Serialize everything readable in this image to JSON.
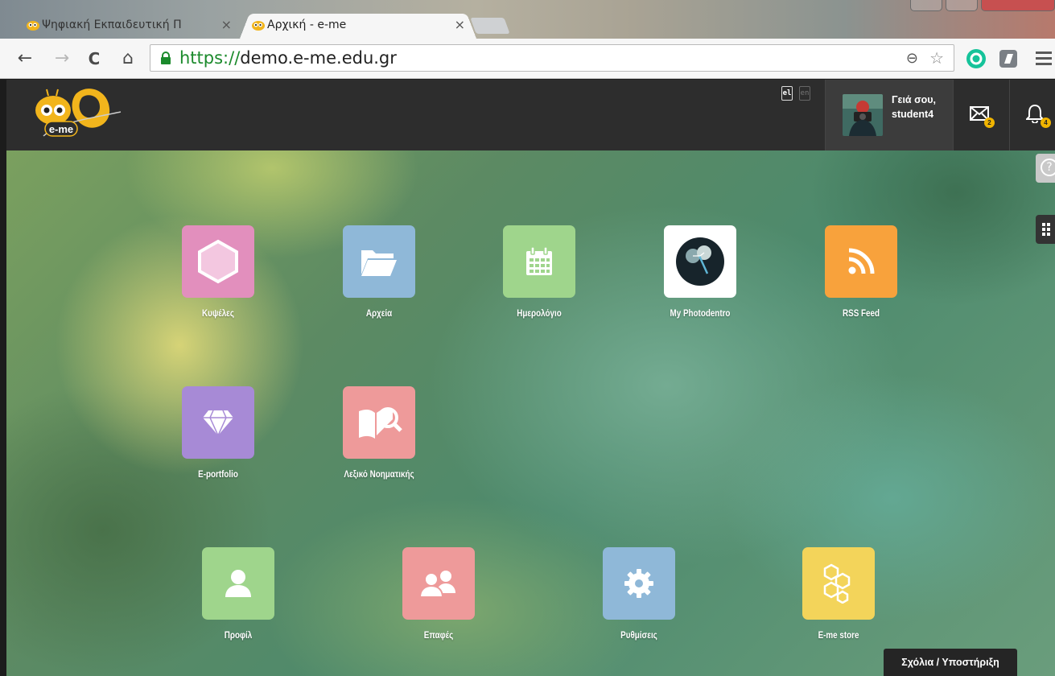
{
  "browser": {
    "tabs": [
      {
        "title": "Ψηφιακή Εκπαιδευτική Π",
        "close": "×",
        "active": false
      },
      {
        "title": "Αρχική - e-me",
        "close": "×",
        "active": true
      }
    ],
    "url_scheme": "https://",
    "url_host": "demo.e-me.edu.gr",
    "nav": {
      "back": "←",
      "forward": "→",
      "reload": "C",
      "home": "⌂"
    },
    "zoom_glyph": "⊖",
    "star_glyph": "☆"
  },
  "header": {
    "logo_text": "e-me",
    "lang_el": "el",
    "lang_en": "en",
    "greeting_line1": "Γειά σου,",
    "greeting_line2": "student4",
    "messages_badge": "2",
    "notifications_badge": "4",
    "help_glyph": "?"
  },
  "apps": [
    {
      "label": "Κυψέλες",
      "icon": "hexagon-icon",
      "color": "#e28fbd"
    },
    {
      "label": "Αρχεία",
      "icon": "folder-icon",
      "color": "#8fb8d8"
    },
    {
      "label": "Ημερολόγιο",
      "icon": "calendar-icon",
      "color": "#9fd58c"
    },
    {
      "label": "My Photodentro",
      "icon": "photodentro-icon",
      "color": "#ffffff"
    },
    {
      "label": "RSS Feed",
      "icon": "rss-icon",
      "color": "#f8a23c"
    },
    {
      "label": "E-portfolio",
      "icon": "diamond-icon",
      "color": "#a78ad6"
    },
    {
      "label": "Λεξικό Νοηματικής",
      "icon": "book-search-icon",
      "color": "#ee9a9a"
    },
    {
      "label": "Προφίλ",
      "icon": "user-icon",
      "color": "#9fd58c"
    },
    {
      "label": "Επαφές",
      "icon": "contacts-icon",
      "color": "#ee9a9a"
    },
    {
      "label": "Ρυθμίσεις",
      "icon": "gear-icon",
      "color": "#8fb8d8"
    },
    {
      "label": "E-me store",
      "icon": "honeycomb-icon",
      "color": "#f3d45a"
    }
  ],
  "feedback_label": "Σχόλια / Υποστήριξη"
}
